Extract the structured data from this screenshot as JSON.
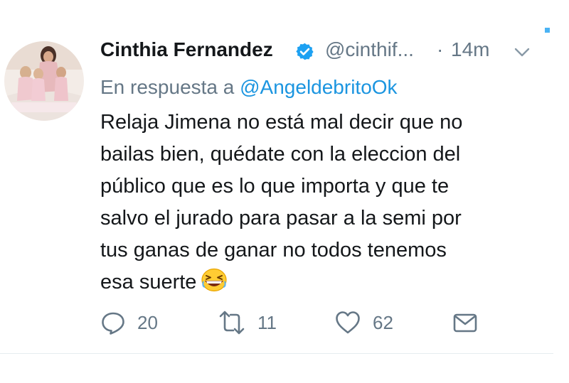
{
  "tweet": {
    "author_name": "Cinthia Fernandez",
    "handle": "@cinthif...",
    "separator": "·",
    "time": "14m",
    "reply_prefix": "En respuesta a",
    "reply_mention": "@AngeldebritoOk",
    "body_lines": [
      "Relaja Jimena no está mal decir que no",
      "bailas bien, quédate con la eleccion del",
      "público que es lo que importa y que te",
      "salvo el jurado para pasar a la semi por",
      "tus ganas de ganar no todos tenemos",
      "esa suerte"
    ],
    "emoji": "grinning-squinting-face-emoji"
  },
  "actions": {
    "reply_count": "20",
    "retweet_count": "11",
    "like_count": "62"
  },
  "icons": [
    "verified-badge-icon",
    "chevron-down-icon",
    "reply-icon",
    "retweet-icon",
    "like-icon",
    "direct-message-icon"
  ],
  "colors": {
    "text": "#14171a",
    "secondary": "#657786",
    "link": "#1b95e0",
    "verified": "#1da1f2",
    "divider": "#e6ecf0"
  }
}
